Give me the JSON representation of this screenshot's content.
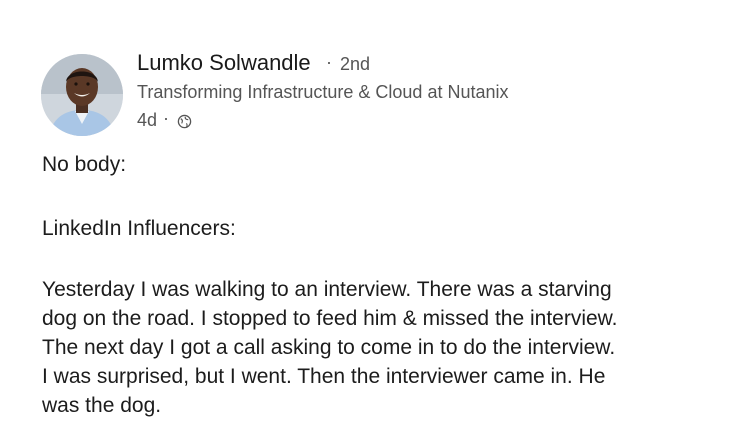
{
  "author": {
    "name": "Lumko Solwandle",
    "separator": "·",
    "degree": "2nd",
    "headline": "Transforming Infrastructure & Cloud at Nutanix",
    "posted_ago": "4d",
    "meta_separator": "·",
    "visibility_icon": "globe-icon"
  },
  "post": {
    "line1": "No body:",
    "line2": "LinkedIn Influencers:",
    "story_lines": [
      "Yesterday I was walking to an interview. There was a starving",
      "dog on the road. I stopped to feed him & missed the interview.",
      "The next day I got a call asking to come in to do the interview.",
      "I was surprised, but I went. Then the interviewer came in. He",
      "was the dog."
    ]
  },
  "colors": {
    "background": "#ffffff",
    "text_primary": "#1c1c1c",
    "text_secondary": "#555555"
  }
}
